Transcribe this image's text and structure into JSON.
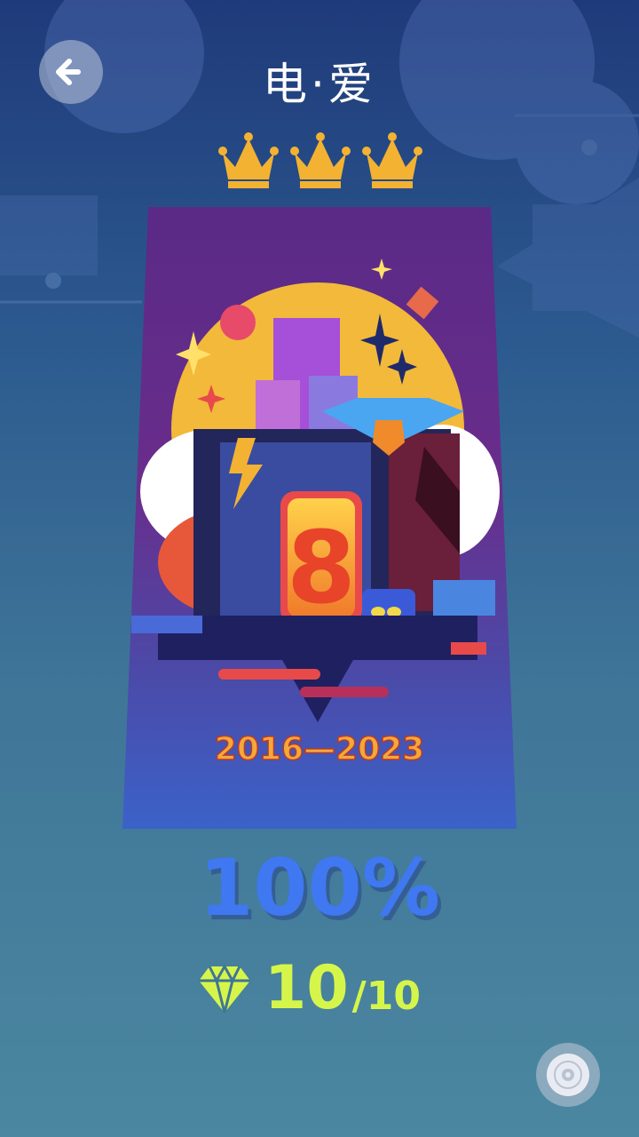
{
  "header": {
    "title": "电·爱",
    "back_icon": "arrow-left-icon",
    "stars_earned": 3
  },
  "poster": {
    "number": "8",
    "years": "2016—2023"
  },
  "result": {
    "percent": "100%",
    "gems": "10",
    "gems_total": "/10",
    "gem_icon": "diamond-icon"
  },
  "footer": {
    "disc_icon": "vinyl-disc-icon"
  },
  "colors": {
    "accent_blue": "#3f78f0",
    "gem_green": "#d6f54a",
    "crown_gold": "#f3b232",
    "poster_purple": "#6a2d8c"
  }
}
